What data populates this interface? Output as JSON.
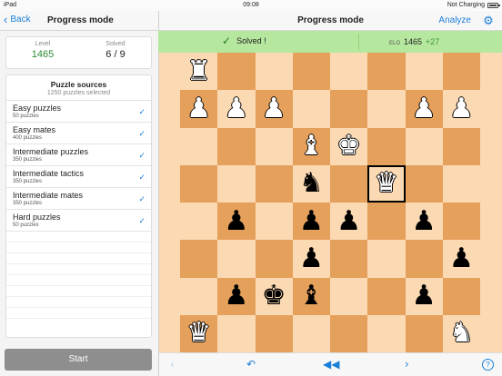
{
  "statusbar": {
    "device": "iPad",
    "time": "09:08",
    "charging": "Not Charging"
  },
  "nav_left": {
    "back_label": "Back",
    "title": "Progress mode"
  },
  "nav_right": {
    "title": "Progress mode",
    "analyze_label": "Analyze",
    "settings_icon": "gear-icon"
  },
  "stats": {
    "level_label": "Level",
    "level_value": "1465",
    "solved_label": "Solved",
    "solved_value": "6 / 9"
  },
  "sources": {
    "title": "Puzzle sources",
    "count": "1250 puzzles selected",
    "items": [
      {
        "name": "Easy puzzles",
        "sub": "50 puzzles",
        "checked": true
      },
      {
        "name": "Easy mates",
        "sub": "400 puzzles",
        "checked": true
      },
      {
        "name": "Intermediate puzzles",
        "sub": "350 puzzles",
        "checked": true
      },
      {
        "name": "Intermediate tactics",
        "sub": "350 puzzles",
        "checked": true
      },
      {
        "name": "Intermediate mates",
        "sub": "350 puzzles",
        "checked": true
      },
      {
        "name": "Hard puzzles",
        "sub": "50 puzzles",
        "checked": true
      }
    ]
  },
  "start_label": "Start",
  "banner": {
    "message": "Solved !",
    "elo_label": "ELO",
    "elo_value": "1465",
    "elo_delta": "+27",
    "color": "#b6e79e"
  },
  "board": {
    "light_color": "#fbd9b2",
    "dark_color": "#e5a05c",
    "highlight": [
      3,
      5
    ],
    "rows": [
      [
        "wR",
        "",
        "",
        "",
        "",
        "",
        "",
        ""
      ],
      [
        "wP",
        "wP",
        "wP",
        "",
        "",
        "",
        "wP",
        "wP"
      ],
      [
        "",
        "",
        "",
        "wB",
        "wK",
        "",
        "",
        ""
      ],
      [
        "",
        "",
        "",
        "bN",
        "",
        "wQ",
        "",
        ""
      ],
      [
        "",
        "bP",
        "",
        "bP",
        "bP",
        "",
        "bP",
        ""
      ],
      [
        "",
        "",
        "",
        "bP",
        "",
        "",
        "",
        "bP"
      ],
      [
        "",
        "bP",
        "bK",
        "bB",
        "",
        "",
        "bP",
        ""
      ],
      [
        "wQ",
        "",
        "",
        "",
        "",
        "",
        "",
        "wN"
      ]
    ]
  },
  "toolbar": {
    "buttons": [
      {
        "name": "prev-move-icon",
        "glyph": "‹",
        "enabled": false
      },
      {
        "name": "undo-icon",
        "glyph": "↶",
        "enabled": true
      },
      {
        "name": "rewind-icon",
        "glyph": "◀◀",
        "enabled": true
      },
      {
        "name": "next-move-icon",
        "glyph": "›",
        "enabled": true
      },
      {
        "name": "help-icon",
        "glyph": "?",
        "enabled": true
      }
    ]
  }
}
